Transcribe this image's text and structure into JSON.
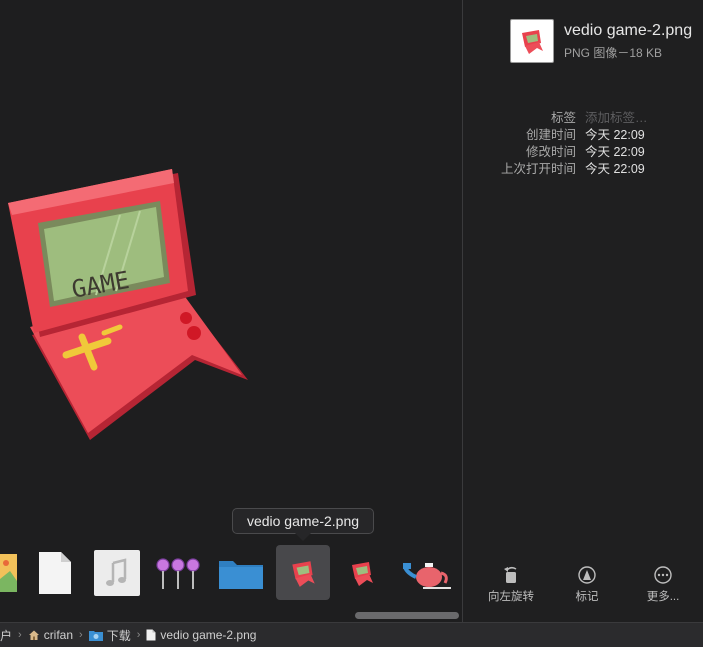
{
  "file": {
    "name": "vedio game-2.png",
    "kind": "PNG 图像－18 KB"
  },
  "metadata": [
    {
      "label": "标签",
      "value": "添加标签…",
      "placeholder": true
    },
    {
      "label": "创建时间",
      "value": "今天 22:09",
      "placeholder": false
    },
    {
      "label": "修改时间",
      "value": "今天 22:09",
      "placeholder": false
    },
    {
      "label": "上次打开时间",
      "value": "今天 22:09",
      "placeholder": false
    }
  ],
  "actions": {
    "rotate_left": "向左旋转",
    "markup": "标记",
    "more": "更多..."
  },
  "tooltip": "vedio game-2.png",
  "preview": {
    "game_screen_text": "GAME"
  },
  "path_bar": {
    "items": [
      "户",
      "crifan",
      "下载",
      "vedio game-2.png"
    ]
  },
  "colors": {
    "console_red": "#e8414d",
    "console_dark_red": "#b8202e",
    "screen_green": "#9ebd7e",
    "folder_blue": "#3a8fd3",
    "background": "#1e1e1f"
  }
}
